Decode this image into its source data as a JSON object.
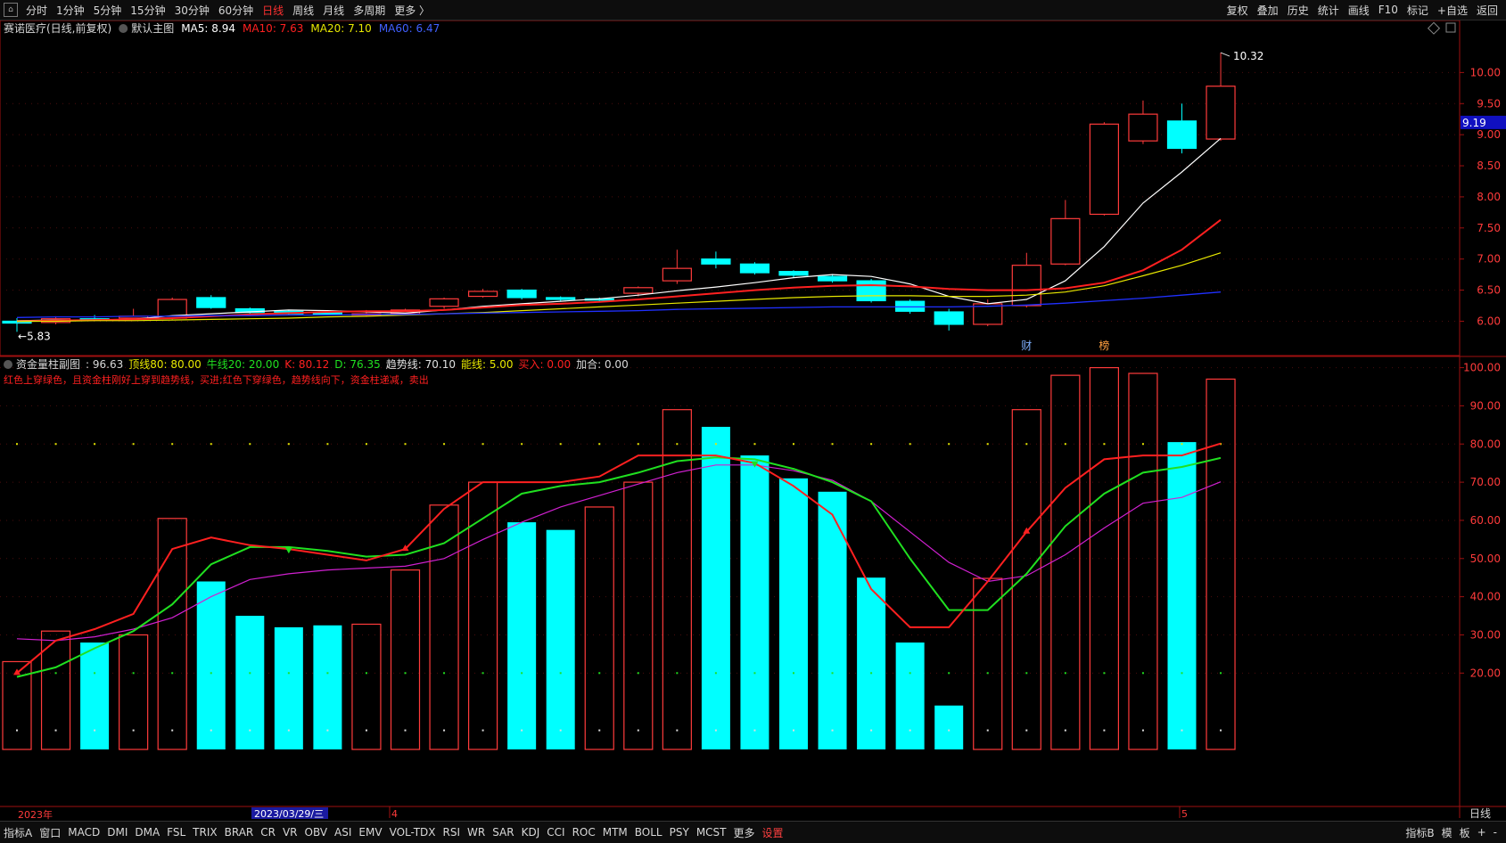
{
  "toolbar": {
    "periods": [
      "分时",
      "1分钟",
      "5分钟",
      "15分钟",
      "30分钟",
      "60分钟",
      "日线",
      "周线",
      "月线",
      "多周期",
      "更多 〉"
    ],
    "active_index": 6,
    "tools": [
      "复权",
      "叠加",
      "历史",
      "统计",
      "画线",
      "F10",
      "标记",
      "+自选",
      "返回"
    ]
  },
  "main": {
    "stock_label": "赛诺医疗(日线,前复权)",
    "template_label": "默认主图",
    "ma5": "MA5: 8.94",
    "ma10": "MA10: 7.63",
    "ma20": "MA20: 7.10",
    "ma60": "MA60: 6.47",
    "high_label": "10.32",
    "low_label": "5.83",
    "price_tag": "9.19",
    "markers": [
      "财",
      "榜"
    ]
  },
  "sub": {
    "indicator_name": "资金量柱副图",
    "v1": ": 96.63",
    "top80": "顶线80: 80.00",
    "bull20": "牛线20: 20.00",
    "k": "K: 80.12",
    "d": "D: 76.35",
    "trend": "趋势线: 70.10",
    "energy": "能线: 5.00",
    "buy": "买入: 0.00",
    "add": "加合: 0.00",
    "note": "红色上穿绿色，且资金柱刚好上穿到趋势线，买进;红色下穿绿色，趋势线向下，资金柱递减，卖出"
  },
  "xaxis": {
    "year": "2023年",
    "cursor_date": "2023/03/29/三",
    "month4": "4",
    "month5": "5",
    "period": "日线"
  },
  "colors": {
    "up": "#ff3b3b",
    "down": "#00ffff",
    "ma5": "#ffffff",
    "ma10": "#ff2020",
    "ma20": "#e8e800",
    "ma60": "#2030ff",
    "k": "#ff2020",
    "d": "#20e020",
    "trend": "#d020d0",
    "axis": "#a01010"
  },
  "bottom": {
    "tabs": [
      "指标A",
      "窗口",
      "MACD",
      "DMI",
      "DMA",
      "FSL",
      "TRIX",
      "BRAR",
      "CR",
      "VR",
      "OBV",
      "ASI",
      "EMV",
      "VOL-TDX",
      "RSI",
      "WR",
      "SAR",
      "KDJ",
      "CCI",
      "ROC",
      "MTM",
      "BOLL",
      "PSY",
      "MCST",
      "更多",
      "设置"
    ],
    "right": [
      "指标B",
      "模",
      "板",
      "+",
      "-"
    ]
  },
  "chart_data": [
    {
      "type": "candlestick",
      "title": "赛诺医疗(日线,前复权)",
      "y_ticks": [
        6.0,
        6.5,
        7.0,
        7.5,
        8.0,
        8.5,
        9.0,
        9.5,
        10.0
      ],
      "ylim": [
        5.72,
        10.55
      ],
      "candles": [
        {
          "o": 6.0,
          "h": 6.05,
          "l": 5.83,
          "c": 5.97
        },
        {
          "o": 5.98,
          "h": 6.08,
          "l": 5.95,
          "c": 6.04
        },
        {
          "o": 6.04,
          "h": 6.1,
          "l": 6.0,
          "c": 6.02
        },
        {
          "o": 6.05,
          "h": 6.2,
          "l": 6.02,
          "c": 6.08
        },
        {
          "o": 6.05,
          "h": 6.38,
          "l": 6.03,
          "c": 6.35
        },
        {
          "o": 6.38,
          "h": 6.42,
          "l": 6.2,
          "c": 6.22
        },
        {
          "o": 6.2,
          "h": 6.22,
          "l": 6.12,
          "c": 6.14
        },
        {
          "o": 6.16,
          "h": 6.18,
          "l": 6.1,
          "c": 6.12
        },
        {
          "o": 6.14,
          "h": 6.15,
          "l": 6.1,
          "c": 6.11
        },
        {
          "o": 6.1,
          "h": 6.18,
          "l": 6.07,
          "c": 6.12
        },
        {
          "o": 6.12,
          "h": 6.2,
          "l": 6.1,
          "c": 6.18
        },
        {
          "o": 6.24,
          "h": 6.38,
          "l": 6.2,
          "c": 6.36
        },
        {
          "o": 6.4,
          "h": 6.52,
          "l": 6.38,
          "c": 6.48
        },
        {
          "o": 6.5,
          "h": 6.52,
          "l": 6.35,
          "c": 6.38
        },
        {
          "o": 6.38,
          "h": 6.4,
          "l": 6.32,
          "c": 6.35
        },
        {
          "o": 6.36,
          "h": 6.38,
          "l": 6.3,
          "c": 6.34
        },
        {
          "o": 6.45,
          "h": 6.56,
          "l": 6.4,
          "c": 6.54
        },
        {
          "o": 6.65,
          "h": 7.15,
          "l": 6.6,
          "c": 6.85
        },
        {
          "o": 7.0,
          "h": 7.12,
          "l": 6.85,
          "c": 6.92
        },
        {
          "o": 6.92,
          "h": 6.95,
          "l": 6.75,
          "c": 6.78
        },
        {
          "o": 6.8,
          "h": 6.82,
          "l": 6.7,
          "c": 6.74
        },
        {
          "o": 6.72,
          "h": 6.76,
          "l": 6.62,
          "c": 6.65
        },
        {
          "o": 6.65,
          "h": 6.68,
          "l": 6.3,
          "c": 6.33
        },
        {
          "o": 6.32,
          "h": 6.35,
          "l": 6.12,
          "c": 6.16
        },
        {
          "o": 6.15,
          "h": 6.2,
          "l": 5.85,
          "c": 5.95
        },
        {
          "o": 5.95,
          "h": 6.35,
          "l": 5.92,
          "c": 6.28
        },
        {
          "o": 6.25,
          "h": 7.1,
          "l": 6.22,
          "c": 6.9
        },
        {
          "o": 6.92,
          "h": 7.95,
          "l": 6.9,
          "c": 7.65
        },
        {
          "o": 7.72,
          "h": 9.2,
          "l": 7.7,
          "c": 9.17
        },
        {
          "o": 8.9,
          "h": 9.55,
          "l": 8.85,
          "c": 9.33
        },
        {
          "o": 9.22,
          "h": 9.5,
          "l": 8.7,
          "c": 8.78
        },
        {
          "o": 8.93,
          "h": 10.32,
          "l": 8.9,
          "c": 9.78
        }
      ],
      "series": [
        {
          "name": "MA5",
          "values": [
            6.01,
            6.02,
            6.02,
            6.03,
            6.09,
            6.12,
            6.15,
            6.18,
            6.17,
            6.15,
            6.13,
            6.18,
            6.24,
            6.28,
            6.32,
            6.36,
            6.42,
            6.49,
            6.55,
            6.62,
            6.7,
            6.75,
            6.72,
            6.6,
            6.4,
            6.28,
            6.35,
            6.65,
            7.2,
            7.9,
            8.4,
            8.94
          ]
        },
        {
          "name": "MA10",
          "values": [
            6.0,
            6.01,
            6.02,
            6.03,
            6.05,
            6.08,
            6.11,
            6.13,
            6.15,
            6.16,
            6.16,
            6.18,
            6.22,
            6.26,
            6.28,
            6.31,
            6.35,
            6.4,
            6.45,
            6.5,
            6.54,
            6.57,
            6.58,
            6.56,
            6.52,
            6.5,
            6.5,
            6.53,
            6.62,
            6.82,
            7.15,
            7.63
          ]
        },
        {
          "name": "MA20",
          "values": [
            6.0,
            6.0,
            6.01,
            6.01,
            6.02,
            6.03,
            6.04,
            6.05,
            6.07,
            6.08,
            6.1,
            6.12,
            6.14,
            6.17,
            6.2,
            6.23,
            6.26,
            6.29,
            6.32,
            6.35,
            6.38,
            6.4,
            6.41,
            6.41,
            6.4,
            6.4,
            6.42,
            6.47,
            6.57,
            6.73,
            6.9,
            7.1
          ]
        },
        {
          "name": "MA60",
          "values": [
            6.06,
            6.07,
            6.07,
            6.08,
            6.08,
            6.09,
            6.09,
            6.1,
            6.1,
            6.11,
            6.11,
            6.12,
            6.13,
            6.14,
            6.15,
            6.16,
            6.17,
            6.19,
            6.2,
            6.21,
            6.22,
            6.23,
            6.23,
            6.23,
            6.23,
            6.24,
            6.26,
            6.29,
            6.33,
            6.37,
            6.42,
            6.47
          ]
        }
      ]
    },
    {
      "type": "bar",
      "title": "资金量柱副图",
      "y_ticks": [
        20.0,
        30.0,
        40.0,
        50.0,
        60.0,
        70.0,
        80.0,
        90.0,
        100.0
      ],
      "ylim": [
        0,
        102
      ],
      "bars": [
        {
          "v": 23,
          "dir": "up"
        },
        {
          "v": 31,
          "dir": "up"
        },
        {
          "v": 28,
          "dir": "down"
        },
        {
          "v": 30,
          "dir": "up"
        },
        {
          "v": 60.5,
          "dir": "up"
        },
        {
          "v": 44,
          "dir": "down"
        },
        {
          "v": 35,
          "dir": "down"
        },
        {
          "v": 32,
          "dir": "down"
        },
        {
          "v": 32.5,
          "dir": "down"
        },
        {
          "v": 32.8,
          "dir": "up"
        },
        {
          "v": 47,
          "dir": "up"
        },
        {
          "v": 64,
          "dir": "up"
        },
        {
          "v": 70,
          "dir": "up"
        },
        {
          "v": 59.5,
          "dir": "down"
        },
        {
          "v": 57.5,
          "dir": "down"
        },
        {
          "v": 63.5,
          "dir": "up"
        },
        {
          "v": 70,
          "dir": "up"
        },
        {
          "v": 89,
          "dir": "up"
        },
        {
          "v": 84.5,
          "dir": "down"
        },
        {
          "v": 77,
          "dir": "down"
        },
        {
          "v": 71,
          "dir": "down"
        },
        {
          "v": 67.5,
          "dir": "down"
        },
        {
          "v": 45,
          "dir": "down"
        },
        {
          "v": 28,
          "dir": "down"
        },
        {
          "v": 11.5,
          "dir": "down"
        },
        {
          "v": 44.8,
          "dir": "up"
        },
        {
          "v": 89,
          "dir": "up"
        },
        {
          "v": 98,
          "dir": "up"
        },
        {
          "v": 100,
          "dir": "up"
        },
        {
          "v": 98.5,
          "dir": "up"
        },
        {
          "v": 80.5,
          "dir": "down"
        },
        {
          "v": 97,
          "dir": "up"
        }
      ],
      "series": [
        {
          "name": "K",
          "values": [
            20,
            28.5,
            31.5,
            35.5,
            52.5,
            55.5,
            53.5,
            52.5,
            51,
            49.5,
            52.5,
            63,
            70,
            70,
            70,
            71.5,
            77,
            77,
            77,
            75,
            69,
            61.5,
            42,
            32,
            32,
            44,
            57,
            68.5,
            76,
            77,
            77,
            80.12
          ]
        },
        {
          "name": "D",
          "values": [
            19,
            21.5,
            26.5,
            31,
            38,
            48.5,
            53,
            53,
            52,
            50.5,
            51,
            54,
            60.5,
            67,
            69,
            70,
            72.5,
            75.5,
            76.5,
            76,
            73.5,
            70,
            65,
            50,
            36.5,
            36.5,
            46,
            58.5,
            67,
            72.5,
            74,
            76.35
          ]
        },
        {
          "name": "趋势线",
          "values": [
            29,
            28.5,
            29.5,
            31.5,
            34.5,
            40,
            44.5,
            46,
            47,
            47.5,
            48,
            50,
            55,
            59.5,
            63.5,
            66.5,
            69.5,
            72.5,
            74.5,
            74.5,
            73,
            70.5,
            65,
            57,
            49,
            44,
            45.5,
            51,
            58,
            64.5,
            66,
            70.1
          ]
        }
      ]
    }
  ]
}
